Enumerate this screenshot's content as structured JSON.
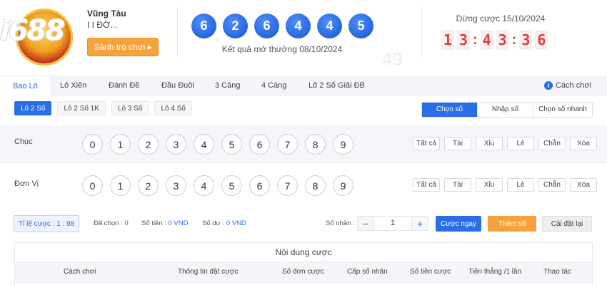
{
  "header": {
    "logo_text": "i688",
    "region_name": "Vũng Tàu",
    "region_sub": "I I ĐỜ...",
    "lobby_button": "Sảnh trò chơi ▸",
    "result_balls": [
      "6",
      "2",
      "6",
      "4",
      "4",
      "5"
    ],
    "result_label": "Kết quả mở thưởng 08/10/2024",
    "stop_label": "Dừng cược 15/10/2024",
    "timer_digits": [
      "1",
      "3",
      "4",
      "3",
      "3",
      "6"
    ],
    "timer_sep": ":"
  },
  "tabs": {
    "items": [
      "Bao Lô",
      "Lô Xiên",
      "Đánh Đề",
      "Đầu Đuôi",
      "3 Càng",
      "4 Càng",
      "Lô 2 Số Giải ĐB"
    ],
    "active": "Bao Lô",
    "howto_icon": "info-icon",
    "howto_label": "Cách chơi"
  },
  "subtabs": {
    "items": [
      "Lô 2 Số",
      "Lô 2 Số 1K",
      "Lô 3 Số",
      "Lô 4 Số"
    ],
    "active": "Lô 2 Số"
  },
  "modes": {
    "items": [
      "Chọn số",
      "Nhập số",
      "Chọn số nhanh"
    ],
    "active": "Chọn số"
  },
  "rows": [
    {
      "label": "Chục",
      "numbers": [
        "0",
        "1",
        "2",
        "3",
        "4",
        "5",
        "6",
        "7",
        "8",
        "9"
      ]
    },
    {
      "label": "Đơn Vị",
      "numbers": [
        "0",
        "1",
        "2",
        "3",
        "4",
        "5",
        "6",
        "7",
        "8",
        "9"
      ]
    }
  ],
  "quick_buttons": [
    "Tất cả",
    "Tài",
    "Xỉu",
    "Lẻ",
    "Chẵn",
    "Xóa"
  ],
  "betbar": {
    "ratio_label": "Tỉ lệ cược : 1 : 98",
    "chosen_label": "Đã chọn :",
    "chosen_value": "0",
    "amount_label": "Số tiền :",
    "amount_value": "0 VND",
    "balance_label": "Số dư :",
    "balance_value": "0 VND",
    "multiplier_label": "Số nhân :",
    "multiplier_value": "1",
    "minus": "−",
    "plus": "+",
    "bet_now": "Cược ngay",
    "add_number": "Thêm số",
    "reset": "Cài đặt lại"
  },
  "table": {
    "title": "Nội dung cược",
    "headers": [
      "Cách chơi",
      "Thông tin đặt cược",
      "Số đơn cược",
      "Cấp số nhân",
      "Số tiền cược",
      "Tiền thắng /1 lần",
      "Thao tác"
    ]
  },
  "colors": {
    "accent_blue": "#2a6ee8",
    "timer_red": "#e03c3c",
    "orange": "#f7a23a"
  }
}
